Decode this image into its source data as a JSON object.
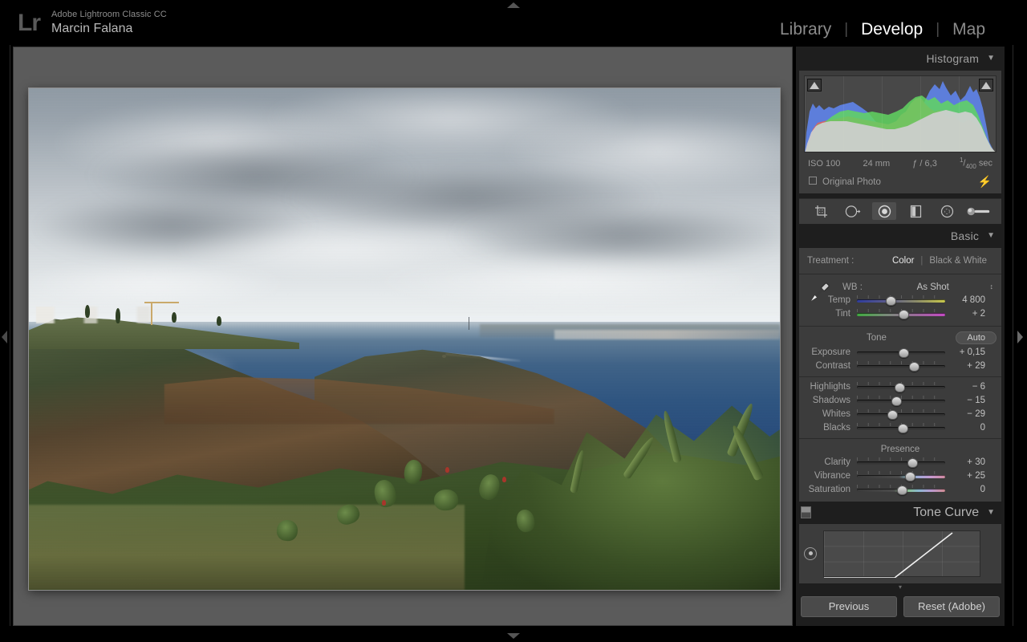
{
  "app": {
    "logo": "Lr",
    "product": "Adobe Lightroom Classic CC",
    "user": "Marcin Falana"
  },
  "modules": [
    {
      "label": "Library",
      "active": false
    },
    {
      "label": "Develop",
      "active": true
    },
    {
      "label": "Map",
      "active": false
    }
  ],
  "module_separator": "|",
  "histogram": {
    "title": "Histogram",
    "caret": "▼",
    "exif": {
      "iso": "ISO 100",
      "focal": "24 mm",
      "aperture": "ƒ / 6,3",
      "shutter_num": "1",
      "shutter_den": "400",
      "shutter_unit": "sec"
    },
    "original_photo_label": "Original Photo",
    "bolt_icon": "⚡"
  },
  "tools": [
    {
      "name": "crop-overlay-tool",
      "active": false
    },
    {
      "name": "spot-removal-tool",
      "active": false
    },
    {
      "name": "red-eye-correction-tool",
      "active": true
    },
    {
      "name": "graduated-filter-tool",
      "active": false
    },
    {
      "name": "radial-filter-tool",
      "active": false
    },
    {
      "name": "adjustment-brush-tool",
      "active": false
    }
  ],
  "basic": {
    "title": "Basic",
    "caret": "▼",
    "treatment_label": "Treatment :",
    "treatment_options": [
      {
        "label": "Color",
        "active": true
      },
      {
        "label": "Black & White",
        "active": false
      }
    ],
    "treatment_separator": "|",
    "wb_label": "WB :",
    "wb_value": "As Shot",
    "wb_stepper": "↕",
    "white_balance_sliders": [
      {
        "name": "Temp",
        "value": "4 800",
        "pos": 39,
        "grad": "grad-temp"
      },
      {
        "name": "Tint",
        "value": "+ 2",
        "pos": 53,
        "grad": "grad-tint"
      }
    ],
    "tone_label": "Tone",
    "auto_label": "Auto",
    "tone_sliders": [
      {
        "name": "Exposure",
        "value": "+ 0,15",
        "pos": 53,
        "grad": ""
      },
      {
        "name": "Contrast",
        "value": "+ 29",
        "pos": 65,
        "grad": ""
      }
    ],
    "tone_sliders2": [
      {
        "name": "Highlights",
        "value": "− 6",
        "pos": 49,
        "grad": ""
      },
      {
        "name": "Shadows",
        "value": "− 15",
        "pos": 45,
        "grad": ""
      },
      {
        "name": "Whites",
        "value": "− 29",
        "pos": 40,
        "grad": ""
      },
      {
        "name": "Blacks",
        "value": "0",
        "pos": 52,
        "grad": ""
      }
    ],
    "presence_label": "Presence",
    "presence_sliders": [
      {
        "name": "Clarity",
        "value": "+ 30",
        "pos": 63,
        "grad": ""
      },
      {
        "name": "Vibrance",
        "value": "+ 25",
        "pos": 60,
        "grad": "grad-vib"
      },
      {
        "name": "Saturation",
        "value": "0",
        "pos": 51,
        "grad": "grad-sat"
      }
    ]
  },
  "tone_curve": {
    "title": "Tone Curve",
    "caret": "▼"
  },
  "footer": {
    "previous_label": "Previous",
    "reset_label": "Reset (Adobe)",
    "collapse_caret": "▾"
  },
  "colors": {
    "panel_bg": "#1e1e1e",
    "panel_body": "#3c3c3c",
    "text": "#a0a0a0",
    "value_text": "#c2c2c2",
    "active_text": "#ffffff",
    "viewport_bg": "#5b5b5b"
  },
  "photo": {
    "description": "Coastal cliff landscape with overcast sky, deep blue ocean and cactus foreground"
  }
}
